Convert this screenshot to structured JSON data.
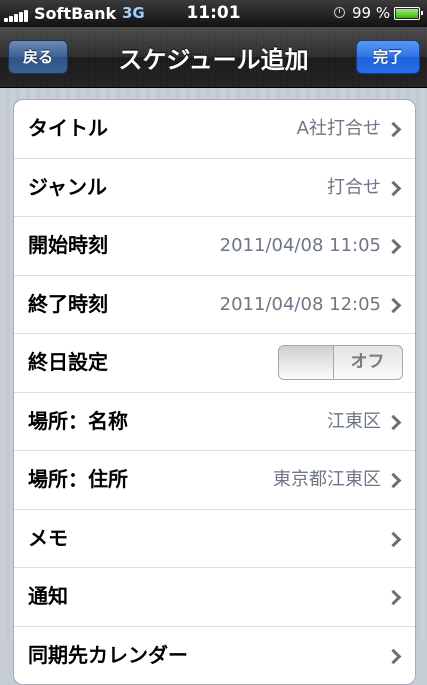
{
  "status_bar": {
    "carrier": "SoftBank",
    "network": "3G",
    "time": "11:01",
    "battery_percent": "99 %",
    "icons": [
      "signal-bars-icon",
      "clock-icon",
      "battery-icon"
    ]
  },
  "nav": {
    "back_label": "戻る",
    "title": "スケジュール追加",
    "done_label": "完了"
  },
  "form": {
    "rows": [
      {
        "label": "タイトル",
        "value": "A社打合せ"
      },
      {
        "label": "ジャンル",
        "value": "打合せ"
      },
      {
        "label": "開始時刻",
        "value": "2011/04/08 11:05"
      },
      {
        "label": "終了時刻",
        "value": "2011/04/08 12:05"
      },
      {
        "label": "終日設定",
        "toggle": "オフ"
      },
      {
        "label": "場所：名称",
        "value": "江東区"
      },
      {
        "label": "場所：住所",
        "value": "東京都江東区"
      },
      {
        "label": "メモ",
        "value": ""
      },
      {
        "label": "通知",
        "value": ""
      },
      {
        "label": "同期先カレンダー",
        "value": ""
      }
    ]
  },
  "colors": {
    "nav_background": "#2c2c2c",
    "done_button": "#2f74e6",
    "back_button": "#3d6094",
    "value_text": "#6e7785",
    "page_background": "#c5ccd4"
  }
}
